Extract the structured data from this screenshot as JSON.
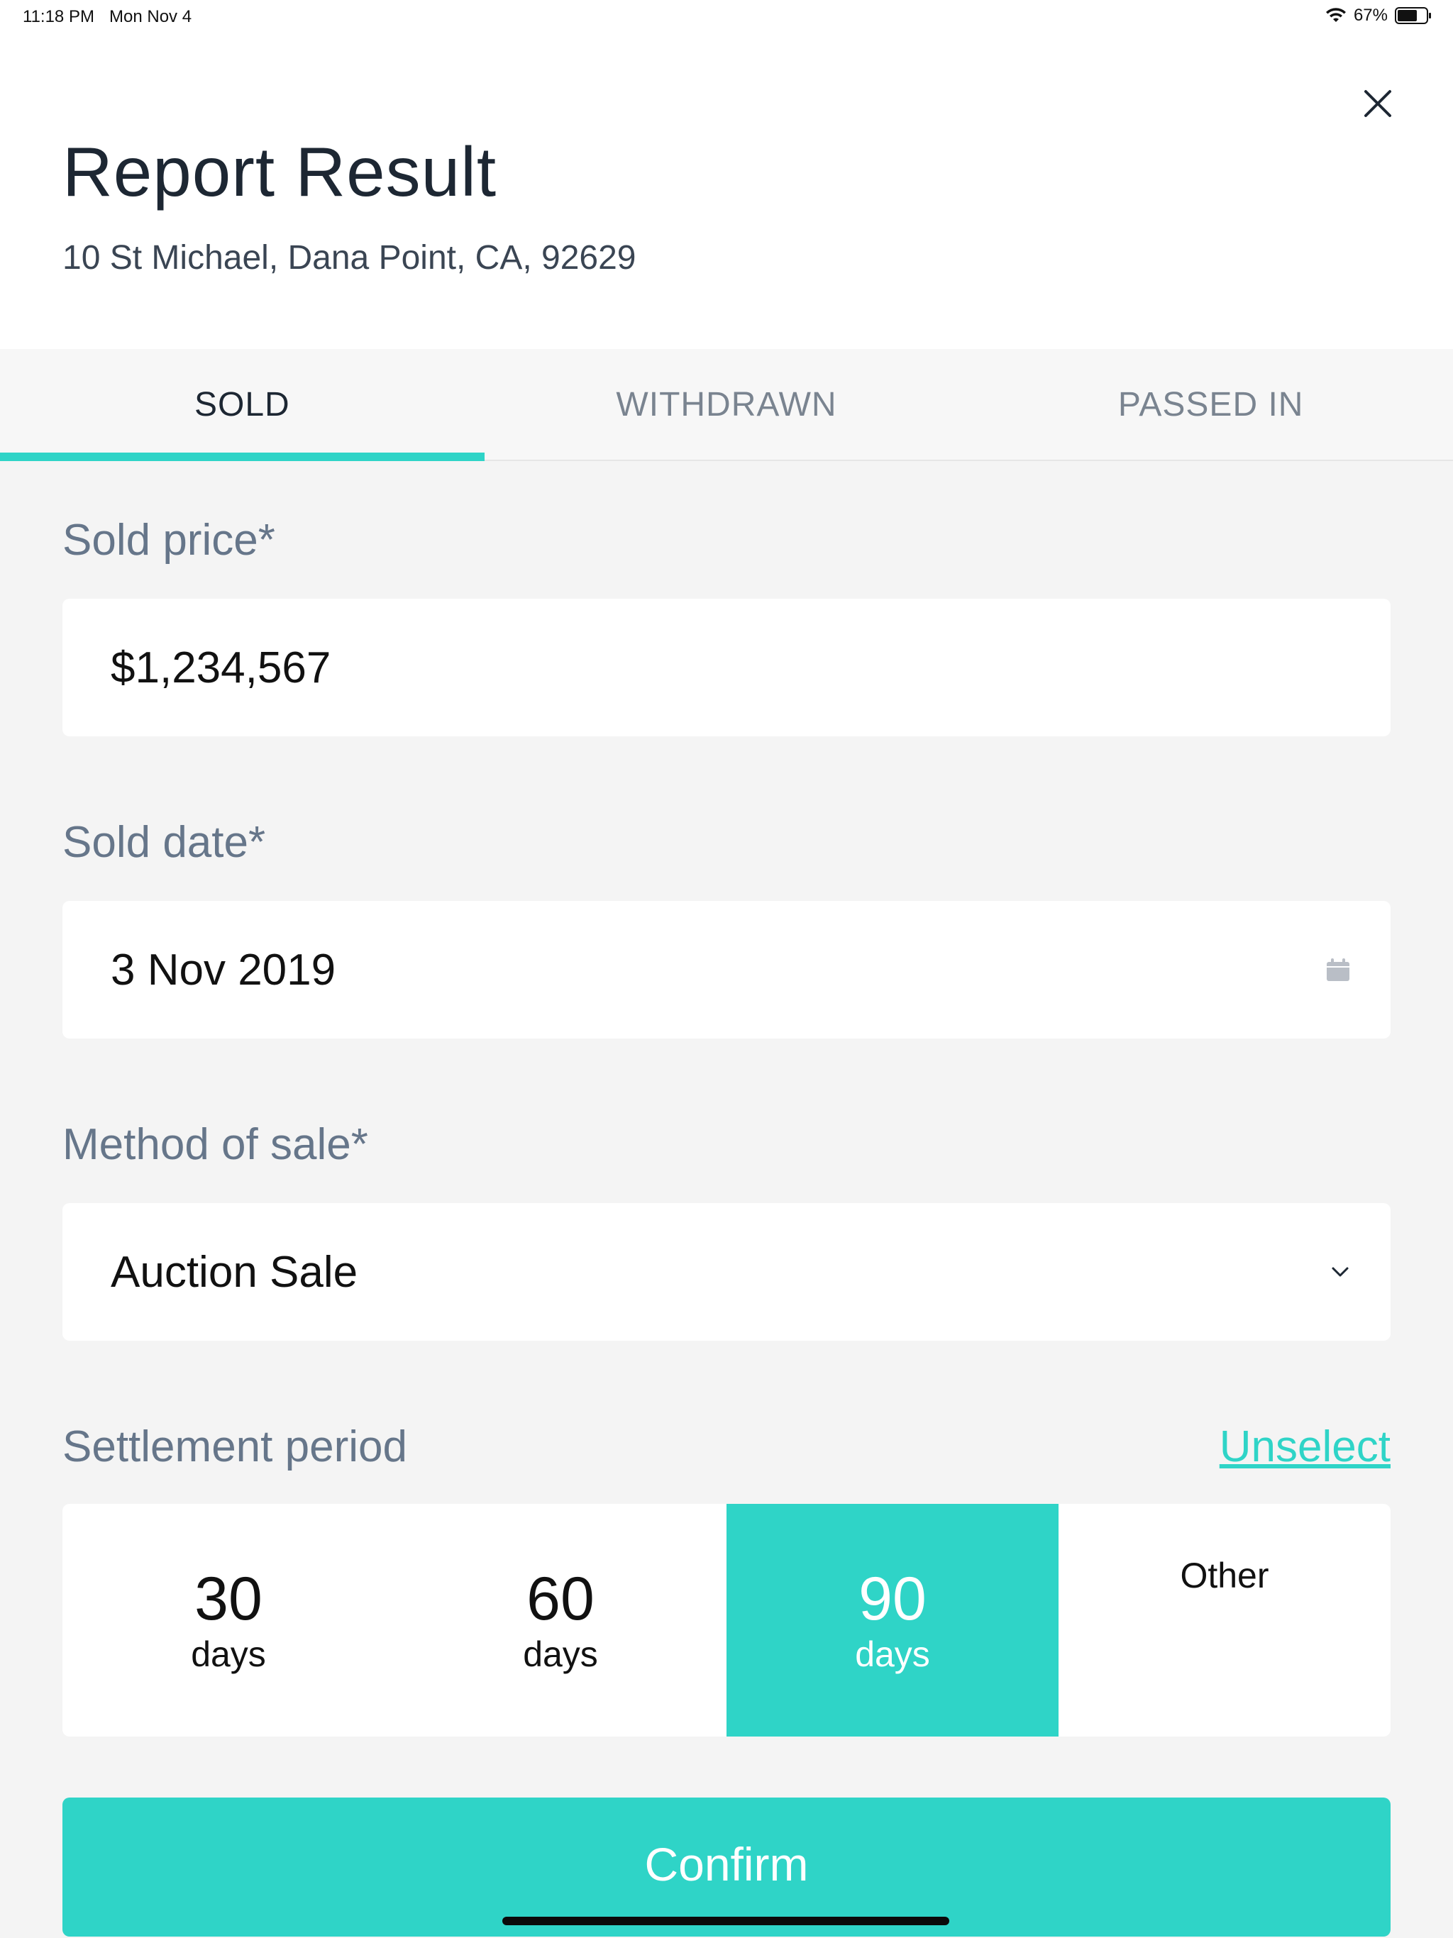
{
  "status_bar": {
    "time": "11:18 PM",
    "date": "Mon Nov 4",
    "battery": "67%"
  },
  "header": {
    "title": "Report Result",
    "address": "10 St Michael, Dana Point, CA, 92629"
  },
  "tabs": [
    {
      "label": "SOLD",
      "active": true
    },
    {
      "label": "WITHDRAWN",
      "active": false
    },
    {
      "label": "PASSED IN",
      "active": false
    }
  ],
  "form": {
    "sold_price": {
      "label": "Sold price*",
      "value": "$1,234,567"
    },
    "sold_date": {
      "label": "Sold date*",
      "value": "3 Nov 2019"
    },
    "method_of_sale": {
      "label": "Method of sale*",
      "value": "Auction Sale"
    },
    "settlement": {
      "label": "Settlement period",
      "unselect": "Unselect",
      "options": [
        {
          "number": "30",
          "unit": "days",
          "selected": false
        },
        {
          "number": "60",
          "unit": "days",
          "selected": false
        },
        {
          "number": "90",
          "unit": "days",
          "selected": true
        }
      ],
      "other": "Other"
    }
  },
  "confirm_label": "Confirm",
  "colors": {
    "accent": "#2fd4c7",
    "title": "#1d2733",
    "label": "#66768a",
    "background": "#f4f4f4"
  }
}
